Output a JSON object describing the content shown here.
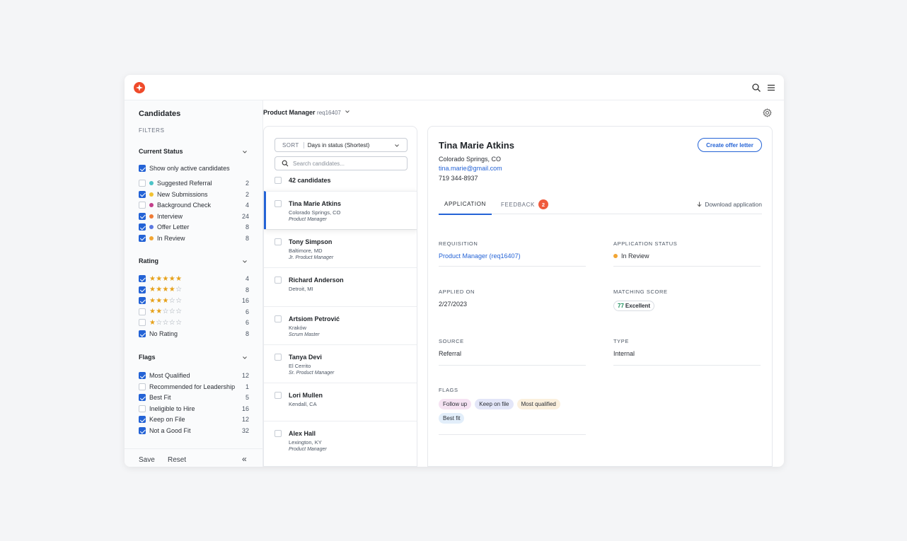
{
  "colors": {
    "accent": "#2463d6",
    "brand": "#ef4a2a",
    "badge": "#ef5a3c"
  },
  "topbar": {
    "logo_icon": "spark-logo-icon",
    "search_icon": "search-icon",
    "menu_icon": "hamburger-menu-icon"
  },
  "filters": {
    "title": "Candidates",
    "subtitle": "FILTERS",
    "status": {
      "heading": "Current Status",
      "active_only": {
        "label": "Show only active candidates",
        "checked": true
      },
      "items": [
        {
          "label": "Suggested Referral",
          "count": "2",
          "checked": false,
          "color": "#4cc3c7"
        },
        {
          "label": "New Submissions",
          "count": "2",
          "checked": true,
          "color": "#f2c230"
        },
        {
          "label": "Background Check",
          "count": "4",
          "checked": false,
          "color": "#c23f8a"
        },
        {
          "label": "Interview",
          "count": "24",
          "checked": true,
          "color": "#ee7a35"
        },
        {
          "label": "Offer Letter",
          "count": "8",
          "checked": true,
          "color": "#5b78e0"
        },
        {
          "label": "In Review",
          "count": "8",
          "checked": true,
          "color": "#f2a533"
        }
      ]
    },
    "rating": {
      "heading": "Rating",
      "items": [
        {
          "stars": 5,
          "count": "4",
          "checked": true
        },
        {
          "stars": 4,
          "count": "8",
          "checked": true
        },
        {
          "stars": 3,
          "count": "16",
          "checked": true
        },
        {
          "stars": 2,
          "count": "6",
          "checked": false
        },
        {
          "stars": 1,
          "count": "6",
          "checked": false
        }
      ],
      "no_rating": {
        "label": "No Rating",
        "count": "8",
        "checked": true
      }
    },
    "flags": {
      "heading": "Flags",
      "items": [
        {
          "label": "Most Qualified",
          "count": "12",
          "checked": true
        },
        {
          "label": "Recommended for Leadership",
          "count": "1",
          "checked": false
        },
        {
          "label": "Best Fit",
          "count": "5",
          "checked": true
        },
        {
          "label": "Ineligible to Hire",
          "count": "16",
          "checked": false
        },
        {
          "label": "Keep on File",
          "count": "12",
          "checked": true
        },
        {
          "label": "Not a Good Fit",
          "count": "32",
          "checked": true
        }
      ]
    },
    "footer": {
      "save": "Save",
      "reset": "Reset",
      "collapse": "«"
    }
  },
  "requisition": {
    "title": "Product Manager",
    "id": "req16407"
  },
  "list": {
    "sort_label": "SORT",
    "sort_value": "Days in status (Shortest)",
    "search_placeholder": "Search candidates...",
    "count": "42 candidates",
    "candidates": [
      {
        "name": "Tina Marie Atkins",
        "location": "Colorado Springs, CO",
        "role": "Product Manager",
        "selected": true
      },
      {
        "name": "Tony Simpson",
        "location": "Baltimore, MD",
        "role": "Jr. Product Manager",
        "selected": false
      },
      {
        "name": "Richard Anderson",
        "location": "Detroit, MI",
        "role": "",
        "selected": false
      },
      {
        "name": "Artsiom Petrović",
        "location": "Kraków",
        "role": "Scrum Master",
        "selected": false
      },
      {
        "name": "Tanya Devi",
        "location": "El Cerrito",
        "role": "Sr. Product Manager",
        "selected": false
      },
      {
        "name": "Lori Mullen",
        "location": "Kendall, CA",
        "role": "",
        "selected": false
      },
      {
        "name": "Alex Hall",
        "location": "Lexington, KY",
        "role": "Product Manager",
        "selected": false
      }
    ]
  },
  "detail": {
    "name": "Tina Marie Atkins",
    "location": "Colorado Springs, CO",
    "email": "tina.marie@gmail.com",
    "phone": "719 344-8937",
    "offer_button": "Create offer letter",
    "tabs": {
      "application": "APPLICATION",
      "feedback": "FEEDBACK",
      "feedback_count": "2"
    },
    "download": "Download application",
    "fields": {
      "requisition": {
        "label": "REQUISITION",
        "value": "Product Manager (req16407)"
      },
      "status": {
        "label": "APPLICATION STATUS",
        "value": "In Review",
        "color": "#f2a533"
      },
      "applied": {
        "label": "APPLIED ON",
        "value": "2/27/2023"
      },
      "score": {
        "label": "MATCHING SCORE",
        "number": "77",
        "text": "Excellent"
      },
      "source": {
        "label": "SOURCE",
        "value": "Referral"
      },
      "type": {
        "label": "TYPE",
        "value": "Internal"
      },
      "flags": {
        "label": "FLAGS",
        "chips": [
          {
            "label": "Follow up",
            "bg": "#f6e3f3"
          },
          {
            "label": "Keep on file",
            "bg": "#e3e6f8"
          },
          {
            "label": "Most qualified",
            "bg": "#fbf0de"
          },
          {
            "label": "Best fit",
            "bg": "#e2eefa"
          }
        ]
      }
    }
  }
}
